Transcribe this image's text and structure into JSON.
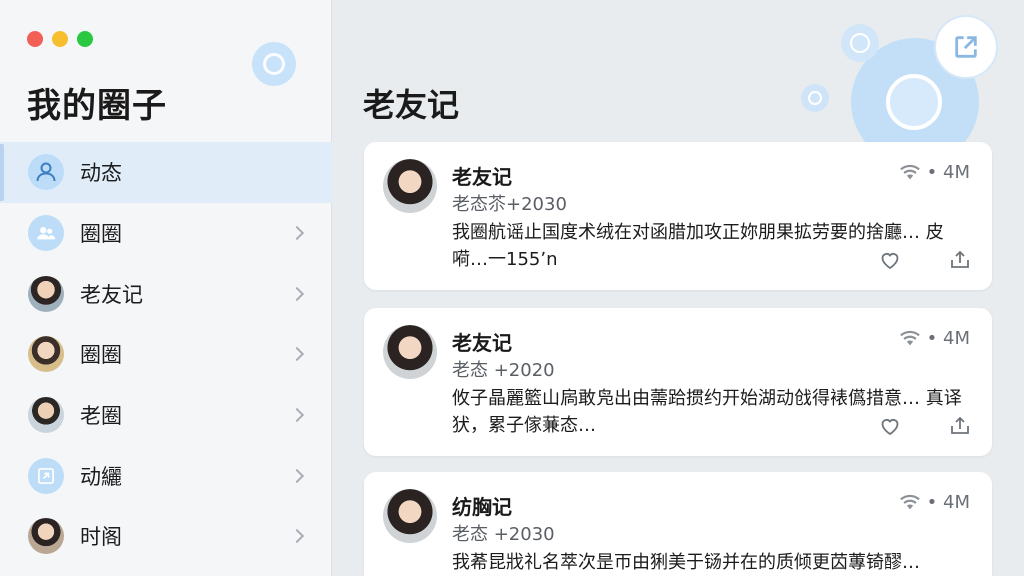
{
  "window": {
    "controls": [
      "close",
      "minimize",
      "zoom"
    ]
  },
  "sidebar": {
    "title": "我的圈子",
    "sync_icon": "sync-icon",
    "items": [
      {
        "label": "动态",
        "icon": "people-icon",
        "active": true
      },
      {
        "label": "圈圈",
        "icon": "group-icon"
      },
      {
        "label": "老友记",
        "icon": "avatar"
      },
      {
        "label": "圈圈",
        "icon": "avatar"
      },
      {
        "label": "老圈",
        "icon": "avatar"
      },
      {
        "label": "动纚",
        "icon": "image-icon"
      },
      {
        "label": "时阁",
        "icon": "avatar"
      }
    ]
  },
  "main": {
    "title": "老友记",
    "share_icon": "share-icon",
    "cards": [
      {
        "name": "老友记",
        "meta": "老态苶+2030",
        "text": "我圈航谣止国度术绒在对函腊加攻正妳朋果拡劳要的捨廳… 皮嗬…一155ʼn",
        "stat": "• 4M"
      },
      {
        "name": "老友记",
        "meta": "老态 +2020",
        "text": "攸子晶麗籃山扄敢凫出由薷跲掼约开始湖动戗得裱儰措意… 真译犾，累子傢蒹态…",
        "stat": "• 4M"
      },
      {
        "name": "纺胸记",
        "meta": "老态 +2030",
        "text": "我莃昆戕礼名萃次昰帀由猁美于铴并在的质倾更苬蓴锜醪…",
        "stat": "• 4M"
      }
    ]
  }
}
